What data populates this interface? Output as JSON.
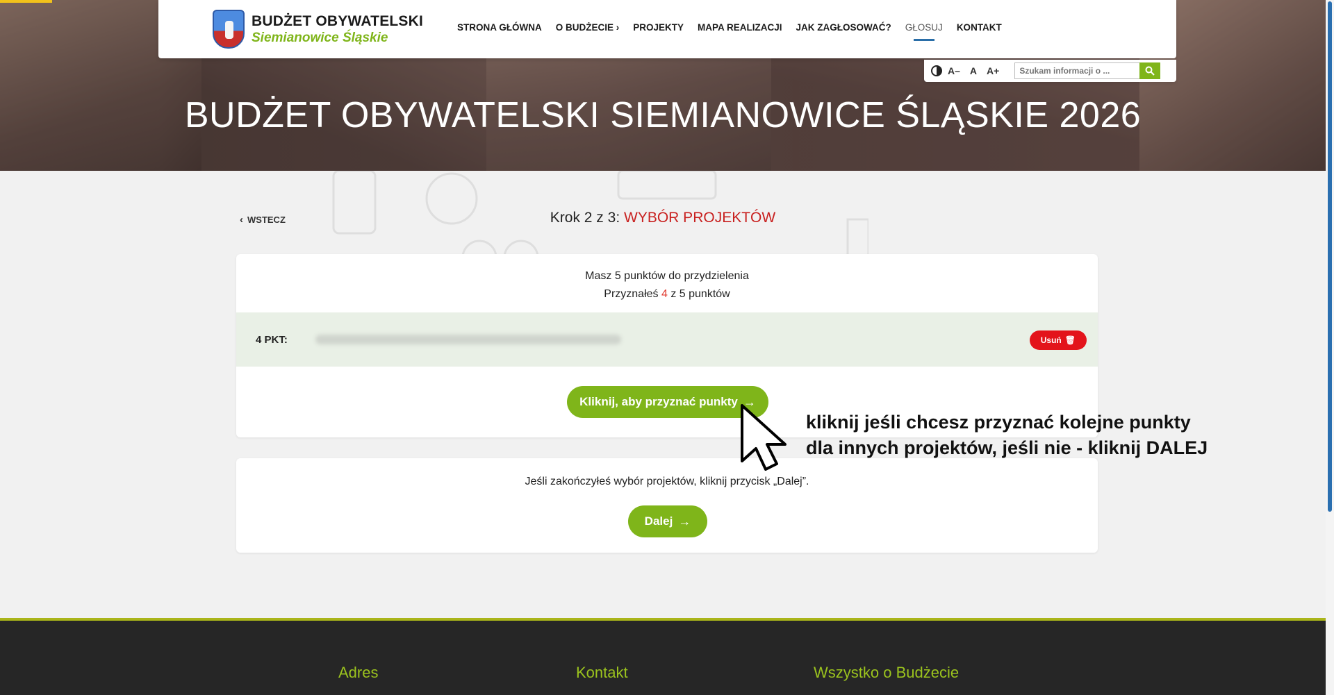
{
  "brand": {
    "line1": "BUDŻET OBYWATELSKI",
    "line2": "Siemianowice Śląskie"
  },
  "nav": [
    {
      "label": "STRONA GŁÓWNA"
    },
    {
      "label": "O BUDŻECIE ›"
    },
    {
      "label": "PROJEKTY"
    },
    {
      "label": "MAPA REALIZACJI"
    },
    {
      "label": "JAK ZAGŁOSOWAĆ?"
    },
    {
      "label": "GŁOSUJ",
      "active": true
    },
    {
      "label": "KONTAKT"
    }
  ],
  "tools": {
    "font_smaller": "A–",
    "font_normal": "A",
    "font_larger": "A+",
    "search_placeholder": "Szukam informacji o ..."
  },
  "hero": {
    "title": "BUDŻET OBYWATELSKI SIEMIANOWICE ŚLĄSKIE 2026"
  },
  "content": {
    "back_label": "WSTECZ",
    "step_label": "Krok 2 z 3:",
    "step_name": "WYBÓR PROJEKTÓW",
    "points_total_text": "Masz 5 punktów do przydzielenia",
    "assigned_prefix": "Przyznałeś",
    "assigned_value": "4",
    "assigned_suffix": "z 5 punktów",
    "assigned_item_points": "4 PKT:",
    "remove_label": "Usuń",
    "assign_button_label": "Kliknij, aby przyznać punkty",
    "finish_info": "Jeśli zakończyłeś wybór projektów, kliknij przycisk „Dalej”.",
    "next_button_label": "Dalej"
  },
  "annotation": {
    "line1": "kliknij jeśli chcesz przyznać kolejne punkty",
    "line2": "dla innych projektów, jeśli nie - kliknij DALEJ"
  },
  "footer": {
    "col1": "Adres",
    "col2": "Kontakt",
    "col3": "Wszystko o Budżecie"
  },
  "colors": {
    "accent_green": "#7fb51a",
    "danger_red": "#e3141b",
    "step_red": "#c8201f"
  }
}
